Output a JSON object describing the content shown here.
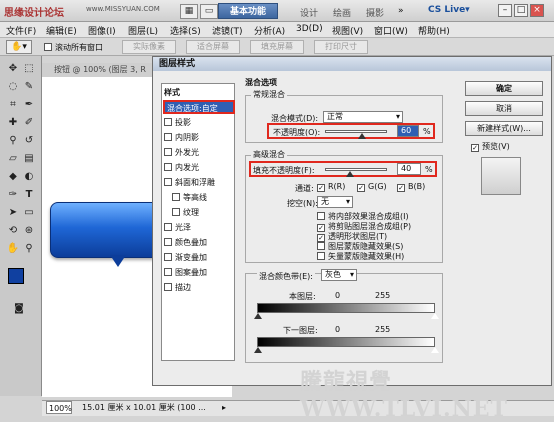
{
  "titlebar": {
    "watermark": "思缘设计论坛",
    "site": "www.MISSYUAN.COM",
    "workspace_active": "基本功能",
    "workspace_tabs": [
      "设计",
      "绘画",
      "摄影"
    ],
    "cslive": "CS Live▾"
  },
  "menu": [
    "文件(F)",
    "编辑(E)",
    "图像(I)",
    "图层(L)",
    "选择(S)",
    "滤镜(T)",
    "分析(A)",
    "3D(D)",
    "视图(V)",
    "窗口(W)",
    "帮助(H)"
  ],
  "options_bar": {
    "scroll_all_label": "滚动所有窗口",
    "buttons": [
      "实际像素",
      "适合屏幕",
      "填充屏幕",
      "打印尺寸"
    ]
  },
  "document": {
    "tab_title": "按钮 @ 100% (图层 3, R",
    "zoom": "100%",
    "size": "15.01 厘米 x 10.01 厘米 (100 ..."
  },
  "dialog": {
    "title": "图层样式",
    "styles_header": "样式",
    "styles": [
      {
        "label": "混合选项:自定",
        "checkbox": false,
        "selected": true,
        "indent": false
      },
      {
        "label": "投影",
        "checkbox": true,
        "selected": false,
        "indent": false
      },
      {
        "label": "内阴影",
        "checkbox": true,
        "selected": false,
        "indent": false
      },
      {
        "label": "外发光",
        "checkbox": true,
        "selected": false,
        "indent": false
      },
      {
        "label": "内发光",
        "checkbox": true,
        "selected": false,
        "indent": false
      },
      {
        "label": "斜面和浮雕",
        "checkbox": true,
        "selected": false,
        "indent": false
      },
      {
        "label": "等高线",
        "checkbox": true,
        "selected": false,
        "indent": true
      },
      {
        "label": "纹理",
        "checkbox": true,
        "selected": false,
        "indent": true
      },
      {
        "label": "光泽",
        "checkbox": true,
        "selected": false,
        "indent": false
      },
      {
        "label": "颜色叠加",
        "checkbox": true,
        "selected": false,
        "indent": false
      },
      {
        "label": "渐变叠加",
        "checkbox": true,
        "selected": false,
        "indent": false
      },
      {
        "label": "图案叠加",
        "checkbox": true,
        "selected": false,
        "indent": false
      },
      {
        "label": "描边",
        "checkbox": true,
        "selected": false,
        "indent": false
      }
    ],
    "blend_options_title": "混合选项",
    "general_title": "常规混合",
    "blend_mode_label": "混合模式(D):",
    "blend_mode_value": "正常",
    "opacity_label": "不透明度(O):",
    "opacity_value": "60",
    "opacity_unit": "%",
    "advanced_title": "高级混合",
    "fill_opacity_label": "填充不透明度(F):",
    "fill_opacity_value": "40",
    "fill_unit": "%",
    "channels_label": "通道:",
    "channels": [
      "R(R)",
      "G(G)",
      "B(B)"
    ],
    "knockout_label": "挖空(N):",
    "knockout_value": "无",
    "adv_options": [
      {
        "label": "将内部效果混合成组(I)",
        "checked": false
      },
      {
        "label": "将剪贴图层混合成组(P)",
        "checked": true
      },
      {
        "label": "透明形状图层(T)",
        "checked": true
      },
      {
        "label": "图层蒙版隐藏效果(S)",
        "checked": false
      },
      {
        "label": "矢量蒙版隐藏效果(H)",
        "checked": false
      }
    ],
    "blend_if_label": "混合颜色带(E):",
    "blend_if_value": "灰色",
    "this_layer_label": "本图层:",
    "underlying_label": "下一图层:",
    "range_min": "0",
    "range_max": "255",
    "buttons": {
      "ok": "确定",
      "cancel": "取消",
      "new_style": "新建样式(W)...",
      "preview": "预览(V)"
    }
  },
  "watermark_bottom": "騰龍視覺 WWW.TLVI.NET",
  "colors": {
    "accent": "#2f5fb3",
    "highlight_box": "#e0281e",
    "button_blue": "#1f67d6",
    "foreground": "#1040a0",
    "background": "#ffffff"
  }
}
